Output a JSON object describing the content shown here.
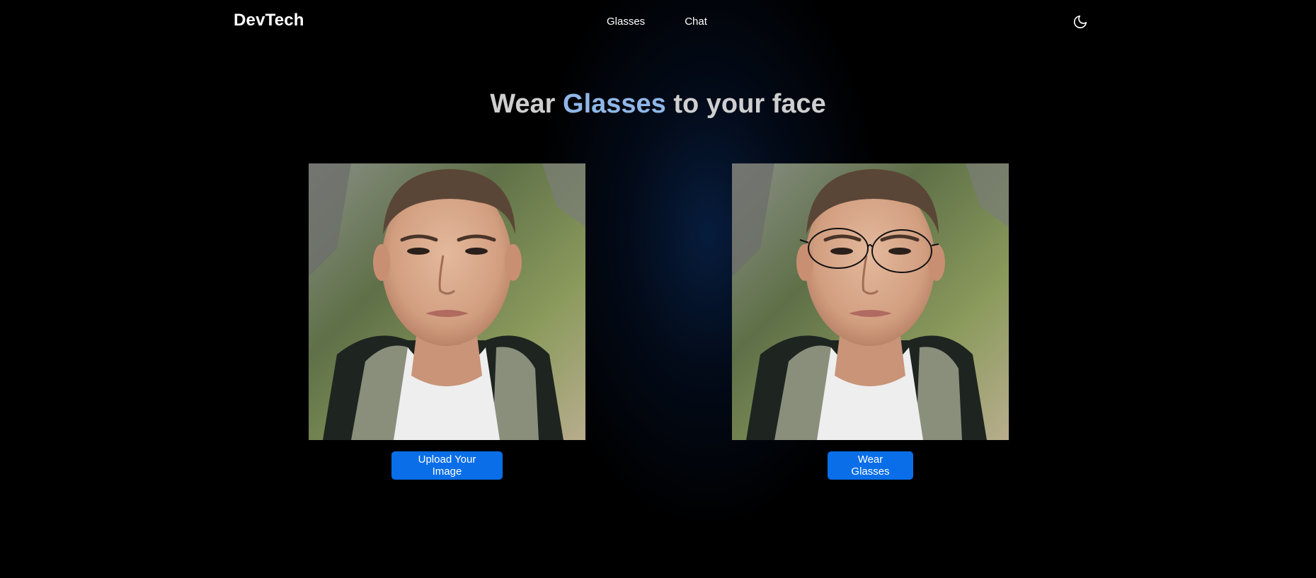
{
  "header": {
    "brand": "DevTech",
    "nav": [
      "Glasses",
      "Chat"
    ],
    "theme_icon": "moon-icon"
  },
  "hero": {
    "title_before": "Wear ",
    "title_accent": "Glasses",
    "title_after": " to your face"
  },
  "panels": {
    "original": {
      "image_description": "portrait-photo",
      "button_label": "Upload Your Image"
    },
    "result": {
      "image_description": "portrait-photo-with-glasses",
      "button_label": "Wear Glasses"
    }
  },
  "colors": {
    "accent": "#0a6ee8",
    "title_accent": "#8fb7e8",
    "title": "#cfcfcf",
    "background": "#000000"
  }
}
